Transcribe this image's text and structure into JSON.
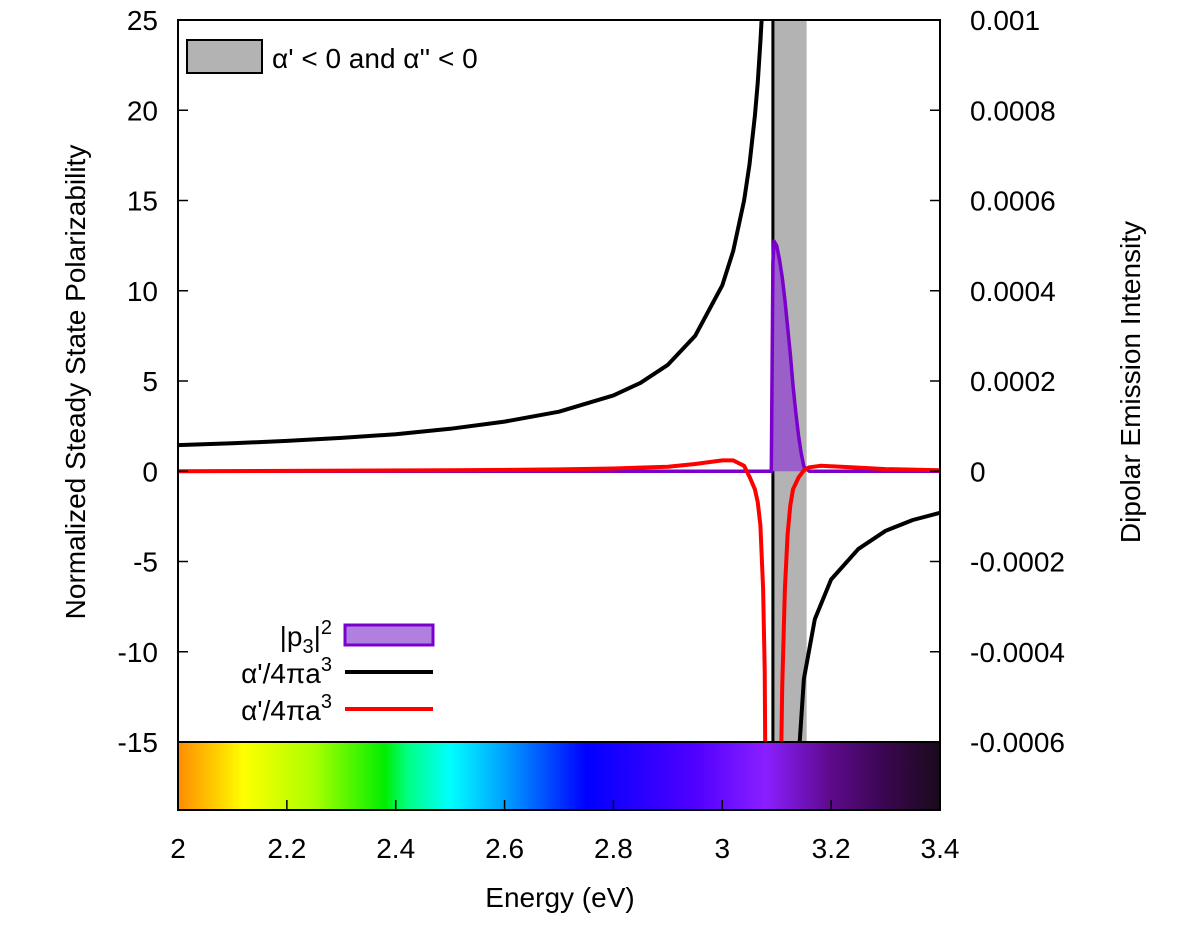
{
  "chart_data": {
    "type": "line",
    "xlabel": "Energy (eV)",
    "ylabel_left": "Normalized Steady State Polarizability",
    "ylabel_right": "Dipolar Emission Intensity",
    "xlim": [
      2,
      3.4
    ],
    "ylim_left": [
      -15,
      25
    ],
    "ylim_right": [
      -0.0006,
      0.001
    ],
    "x_ticks": [
      "2",
      "2.2",
      "2.4",
      "2.6",
      "2.8",
      "3",
      "3.2",
      "3.4"
    ],
    "y_left_ticks": [
      "25",
      "20",
      "15",
      "10",
      "5",
      "0",
      "-5",
      "-10",
      "-15"
    ],
    "y_right_ticks": [
      "0.001",
      "0.0008",
      "0.0006",
      "0.0004",
      "0.0002",
      "0",
      "-0.0002",
      "-0.0004",
      "-0.0006"
    ],
    "shaded_region": {
      "label_parts": [
        "α' < 0 and α'' < 0"
      ],
      "x_start": 3.095,
      "x_end": 3.155,
      "color": "#b3b3b3"
    },
    "vertical_line_x": 3.093,
    "legend_placement": "bottom-left",
    "series": [
      {
        "name_parts": [
          "|p",
          "3",
          "|",
          "2"
        ],
        "axis": "right",
        "style": "filled-area",
        "color": "#7a00cc",
        "fill": "#9a5fc8",
        "x": [
          2.0,
          3.0,
          3.09,
          3.093,
          3.095,
          3.1,
          3.105,
          3.11,
          3.115,
          3.12,
          3.125,
          3.13,
          3.135,
          3.14,
          3.145,
          3.15,
          3.16,
          3.4
        ],
        "y": [
          0,
          0,
          0,
          0.00046,
          0.00051,
          0.0005,
          0.00047,
          0.00043,
          0.00038,
          0.00032,
          0.00026,
          0.00019,
          0.00013,
          8e-05,
          4e-05,
          1e-05,
          0,
          0
        ]
      },
      {
        "name_parts": [
          "α'/4πa",
          "3"
        ],
        "axis": "left",
        "style": "line",
        "color": "#000000",
        "x": [
          2.0,
          2.1,
          2.2,
          2.3,
          2.4,
          2.5,
          2.6,
          2.7,
          2.8,
          2.85,
          2.9,
          2.95,
          3.0,
          3.02,
          3.04,
          3.05,
          3.06,
          3.065,
          3.07,
          3.074,
          3.077,
          3.079,
          3.14,
          3.15,
          3.17,
          3.2,
          3.25,
          3.3,
          3.35,
          3.4
        ],
        "y": [
          1.45,
          1.55,
          1.68,
          1.85,
          2.05,
          2.35,
          2.75,
          3.3,
          4.2,
          4.9,
          5.9,
          7.5,
          10.3,
          12.2,
          15.0,
          17.0,
          19.7,
          21.5,
          23.8,
          26.0,
          28.0,
          30.0,
          -16,
          -11.5,
          -8.2,
          -6.0,
          -4.3,
          -3.3,
          -2.7,
          -2.3
        ]
      },
      {
        "name_parts": [
          "α'/4πa",
          "3"
        ],
        "axis": "left",
        "style": "line",
        "color": "#ff0000",
        "x": [
          2.0,
          2.5,
          2.7,
          2.8,
          2.9,
          2.95,
          3.0,
          3.02,
          3.04,
          3.05,
          3.06,
          3.065,
          3.07,
          3.075,
          3.078,
          3.079,
          3.108,
          3.11,
          3.115,
          3.12,
          3.125,
          3.13,
          3.14,
          3.15,
          3.16,
          3.18,
          3.2,
          3.25,
          3.3,
          3.4
        ],
        "y": [
          0,
          0.05,
          0.1,
          0.15,
          0.25,
          0.4,
          0.6,
          0.6,
          0.3,
          -0.3,
          -1.0,
          -1.7,
          -3.0,
          -6.5,
          -11.0,
          -16,
          -16,
          -12.0,
          -6.5,
          -3.5,
          -1.9,
          -1.0,
          -0.35,
          0.05,
          0.22,
          0.3,
          0.28,
          0.2,
          0.12,
          0.05
        ]
      }
    ],
    "colorbar": {
      "x_range": [
        2,
        3.4
      ],
      "stops": [
        {
          "x": 2.0,
          "color": "#ff8c00"
        },
        {
          "x": 2.08,
          "color": "#ffd700"
        },
        {
          "x": 2.12,
          "color": "#ffff00"
        },
        {
          "x": 2.25,
          "color": "#aaff00"
        },
        {
          "x": 2.38,
          "color": "#00ee00"
        },
        {
          "x": 2.42,
          "color": "#00ff80"
        },
        {
          "x": 2.5,
          "color": "#00ffff"
        },
        {
          "x": 2.6,
          "color": "#00a0ff"
        },
        {
          "x": 2.75,
          "color": "#0000ff"
        },
        {
          "x": 2.95,
          "color": "#5000ff"
        },
        {
          "x": 3.08,
          "color": "#8a1fff"
        },
        {
          "x": 3.2,
          "color": "#5c0a8a"
        },
        {
          "x": 3.3,
          "color": "#3a0650"
        },
        {
          "x": 3.4,
          "color": "#1a0a1a"
        }
      ]
    }
  }
}
